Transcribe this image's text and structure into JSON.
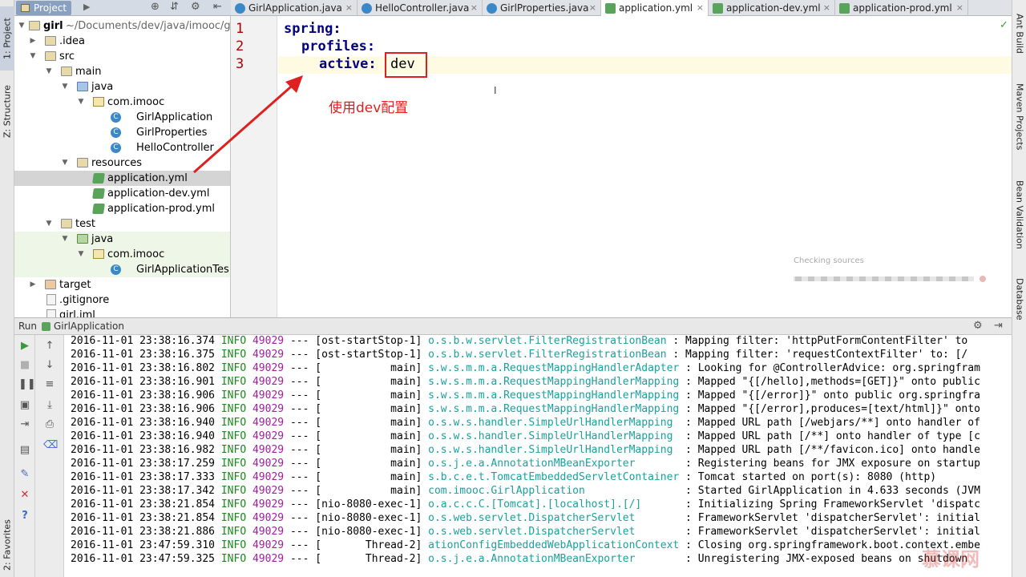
{
  "left_stripe": {
    "project_tab": "1: Project",
    "structure_tab": "Z: Structure",
    "favorites_tab": "2: Favorites"
  },
  "right_stripe": {
    "ant_tab": "Ant Build",
    "maven_tab": "Maven Projects",
    "bean_tab": "Bean Validation",
    "db_tab": "Database"
  },
  "project_panel": {
    "title": "Project",
    "tree": [
      {
        "label": "girl",
        "path": "~/Documents/dev/java/imooc/g",
        "bold": true
      },
      {
        "label": ".idea"
      },
      {
        "label": "src"
      },
      {
        "label": "main"
      },
      {
        "label": "java"
      },
      {
        "label": "com.imooc"
      },
      {
        "label": "GirlApplication"
      },
      {
        "label": "GirlProperties"
      },
      {
        "label": "HelloController"
      },
      {
        "label": "resources"
      },
      {
        "label": "application.yml"
      },
      {
        "label": "application-dev.yml"
      },
      {
        "label": "application-prod.yml"
      },
      {
        "label": "test"
      },
      {
        "label": "java"
      },
      {
        "label": "com.imooc"
      },
      {
        "label": "GirlApplicationTes"
      },
      {
        "label": "target"
      },
      {
        "label": ".gitignore"
      },
      {
        "label": "girl.iml"
      }
    ]
  },
  "editor_tabs": [
    "GirlApplication.java",
    "HelloController.java",
    "GirlProperties.java",
    "application.yml",
    "application-dev.yml",
    "application-prod.yml"
  ],
  "editor": {
    "line_numbers": [
      "1",
      "2",
      "3"
    ],
    "line1": "spring:",
    "line2": "profiles:",
    "line3_key": "active:",
    "line3_value": "dev",
    "annotation": "使用dev配置",
    "checking": "Checking sources"
  },
  "run_panel": {
    "label": "Run",
    "config": "GirlApplication",
    "rows": [
      {
        "ts": "2016-11-01 23:38:16.374",
        "lvl": "INFO",
        "pid": "49029",
        "thr": "[ost-startStop-1]",
        "logger": "o.s.b.w.servlet.FilterRegistrationBean",
        "msg": ": Mapping filter: 'httpPutFormContentFilter' to"
      },
      {
        "ts": "2016-11-01 23:38:16.375",
        "lvl": "INFO",
        "pid": "49029",
        "thr": "[ost-startStop-1]",
        "logger": "o.s.b.w.servlet.FilterRegistrationBean",
        "msg": ": Mapping filter: 'requestContextFilter' to: [/"
      },
      {
        "ts": "2016-11-01 23:38:16.802",
        "lvl": "INFO",
        "pid": "49029",
        "thr": "[           main]",
        "logger": "s.w.s.m.m.a.RequestMappingHandlerAdapter",
        "msg": ": Looking for @ControllerAdvice: org.springfram"
      },
      {
        "ts": "2016-11-01 23:38:16.901",
        "lvl": "INFO",
        "pid": "49029",
        "thr": "[           main]",
        "logger": "s.w.s.m.m.a.RequestMappingHandlerMapping",
        "msg": ": Mapped \"{[/hello],methods=[GET]}\" onto public"
      },
      {
        "ts": "2016-11-01 23:38:16.906",
        "lvl": "INFO",
        "pid": "49029",
        "thr": "[           main]",
        "logger": "s.w.s.m.m.a.RequestMappingHandlerMapping",
        "msg": ": Mapped \"{[/error]}\" onto public org.springfra"
      },
      {
        "ts": "2016-11-01 23:38:16.906",
        "lvl": "INFO",
        "pid": "49029",
        "thr": "[           main]",
        "logger": "s.w.s.m.m.a.RequestMappingHandlerMapping",
        "msg": ": Mapped \"{[/error],produces=[text/html]}\" onto"
      },
      {
        "ts": "2016-11-01 23:38:16.940",
        "lvl": "INFO",
        "pid": "49029",
        "thr": "[           main]",
        "logger": "o.s.w.s.handler.SimpleUrlHandlerMapping",
        "msg": " : Mapped URL path [/webjars/**] onto handler of"
      },
      {
        "ts": "2016-11-01 23:38:16.940",
        "lvl": "INFO",
        "pid": "49029",
        "thr": "[           main]",
        "logger": "o.s.w.s.handler.SimpleUrlHandlerMapping",
        "msg": " : Mapped URL path [/**] onto handler of type [c"
      },
      {
        "ts": "2016-11-01 23:38:16.982",
        "lvl": "INFO",
        "pid": "49029",
        "thr": "[           main]",
        "logger": "o.s.w.s.handler.SimpleUrlHandlerMapping",
        "msg": " : Mapped URL path [/**/favicon.ico] onto handle"
      },
      {
        "ts": "2016-11-01 23:38:17.259",
        "lvl": "INFO",
        "pid": "49029",
        "thr": "[           main]",
        "logger": "o.s.j.e.a.AnnotationMBeanExporter",
        "msg": "       : Registering beans for JMX exposure on startup"
      },
      {
        "ts": "2016-11-01 23:38:17.333",
        "lvl": "INFO",
        "pid": "49029",
        "thr": "[           main]",
        "logger": "s.b.c.e.t.TomcatEmbeddedServletContainer",
        "msg": ": Tomcat started on port(s): 8080 (http)"
      },
      {
        "ts": "2016-11-01 23:38:17.342",
        "lvl": "INFO",
        "pid": "49029",
        "thr": "[           main]",
        "logger": "com.imooc.GirlApplication",
        "msg": "               : Started GirlApplication in 4.633 seconds (JVM"
      },
      {
        "ts": "2016-11-01 23:38:21.854",
        "lvl": "INFO",
        "pid": "49029",
        "thr": "[nio-8080-exec-1]",
        "logger": "o.a.c.c.C.[Tomcat].[localhost].[/]",
        "msg": "      : Initializing Spring FrameworkServlet 'dispatc"
      },
      {
        "ts": "2016-11-01 23:38:21.854",
        "lvl": "INFO",
        "pid": "49029",
        "thr": "[nio-8080-exec-1]",
        "logger": "o.s.web.servlet.DispatcherServlet",
        "msg": "       : FrameworkServlet 'dispatcherServlet': initial"
      },
      {
        "ts": "2016-11-01 23:38:21.886",
        "lvl": "INFO",
        "pid": "49029",
        "thr": "[nio-8080-exec-1]",
        "logger": "o.s.web.servlet.DispatcherServlet",
        "msg": "       : FrameworkServlet 'dispatcherServlet': initial"
      },
      {
        "ts": "2016-11-01 23:47:59.310",
        "lvl": "INFO",
        "pid": "49029",
        "thr": "[       Thread-2]",
        "logger": "ationConfigEmbeddedWebApplicationContext",
        "msg": ": Closing org.springframework.boot.context.embe"
      },
      {
        "ts": "2016-11-01 23:47:59.325",
        "lvl": "INFO",
        "pid": "49029",
        "thr": "[       Thread-2]",
        "logger": "o.s.j.e.a.AnnotationMBeanExporter",
        "msg": "       : Unregistering JMX-exposed beans on shutdown"
      }
    ]
  },
  "watermark": "慕课网"
}
